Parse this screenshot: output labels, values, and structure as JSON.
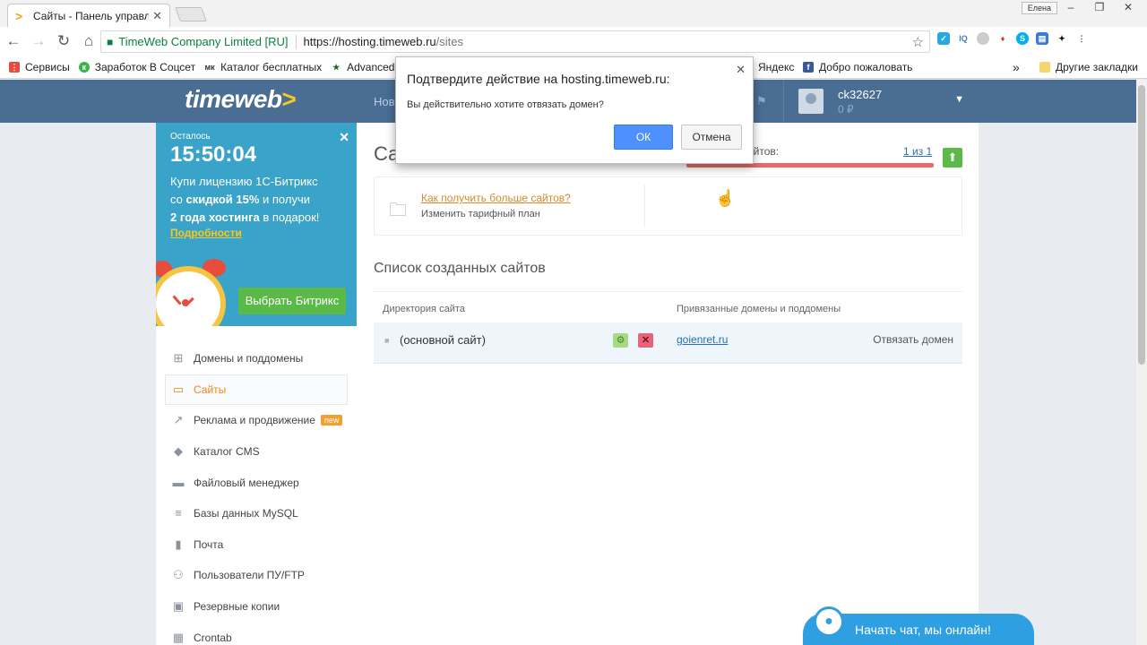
{
  "browser": {
    "tab_title": "Сайты - Панель управле",
    "user_chip": "Елена",
    "security_label": "TimeWeb Company Limited [RU]",
    "url_scheme_host": "https://hosting.timeweb.ru",
    "url_path": "/sites",
    "bookmarks": [
      "Сервисы",
      "Заработок В Соцсет",
      "Каталог бесплатных",
      "Advanced"
    ],
    "bookmarks_right": [
      "Яндекс",
      "Добро пожаловать"
    ],
    "overflow": "»",
    "other_bookmarks": "Другие закладки"
  },
  "site": {
    "logo": "timeweb",
    "nav_partial": "Нов",
    "user_login": "ck32627",
    "user_balance": "0 ₽",
    "promo": {
      "left_label": "Осталось",
      "timer": "15:50:04",
      "line1": "Купи лицензию 1С-Битрикс",
      "line2a": "со ",
      "line2b": "скидкой 15%",
      "line2c": " и получи",
      "line3a": "2 года хостинга",
      "line3b": " в подарок!",
      "details": "Подробности",
      "button": "Выбрать Битрикс"
    },
    "menu": [
      {
        "label": "Домены и поддомены",
        "icon": "sitemap-icon"
      },
      {
        "label": "Сайты",
        "icon": "window-icon"
      },
      {
        "label": "Реклама и продвижение",
        "icon": "chart-icon",
        "badge": "new"
      },
      {
        "label": "Каталог CMS",
        "icon": "cube-icon"
      },
      {
        "label": "Файловый менеджер",
        "icon": "folder-icon"
      },
      {
        "label": "Базы данных MySQL",
        "icon": "database-icon"
      },
      {
        "label": "Почта",
        "icon": "mailbox-icon"
      },
      {
        "label": "Пользователи ПУ/FTP",
        "icon": "users-icon"
      },
      {
        "label": "Резервные копии",
        "icon": "backup-icon"
      },
      {
        "label": "Crontab",
        "icon": "calendar-icon"
      }
    ],
    "page_title_partial": "Са",
    "limit_label_partial": "о сайтов:",
    "limit_count": "1 из 1",
    "more_sites_link": "Как получить больше сайтов?",
    "more_sites_sub": "Изменить тарифный план",
    "list_title": "Список созданных сайтов",
    "col_dir": "Директория сайта",
    "col_domains": "Привязанные домены и поддомены",
    "row": {
      "dir": "(основной сайт)",
      "domain": "goienret.ru",
      "unbind": "Отвязать домен"
    },
    "chat": "Начать чат, мы онлайн!"
  },
  "dialog": {
    "title": "Подтвердите действие на hosting.timeweb.ru:",
    "message": "Вы действительно хотите отвязать домен?",
    "ok": "ОК",
    "cancel": "Отмена"
  },
  "colors": {
    "header": "#4a6d94",
    "promo": "#3aa3c9",
    "accent": "#e88a17",
    "link": "#2a6fb0",
    "dialog_ok": "#4d90fe"
  }
}
